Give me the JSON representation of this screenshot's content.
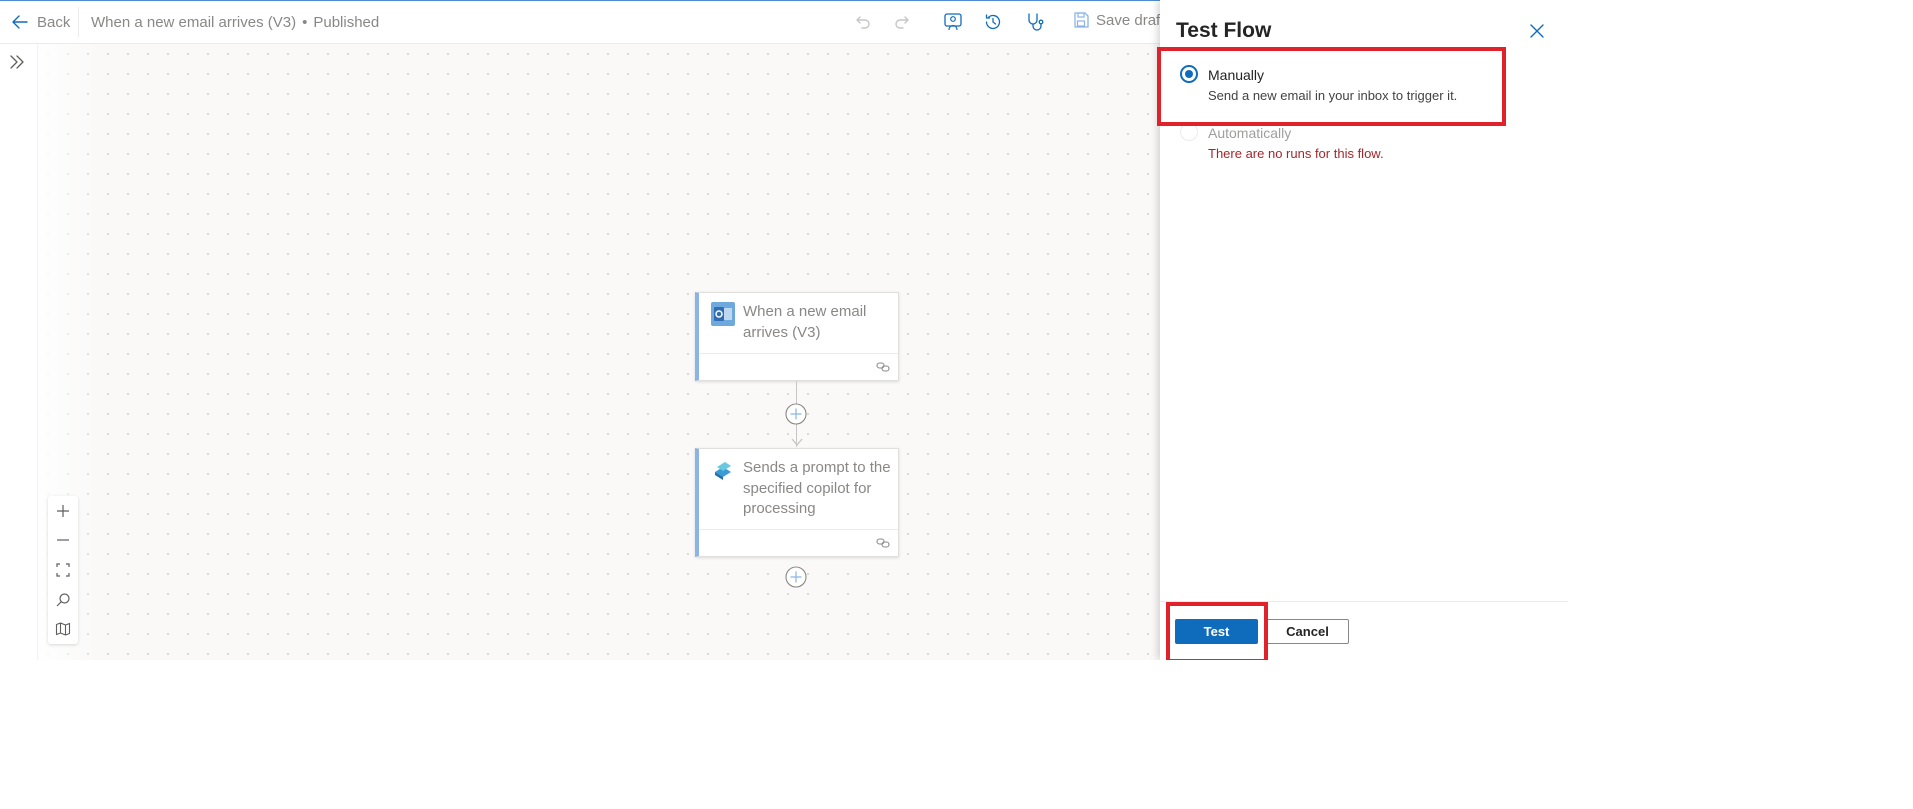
{
  "header": {
    "back_label": "Back",
    "flow_name": "When a new email arrives (V3)",
    "flow_status": "Published",
    "separator": "•",
    "save_draft_label": "Save draft"
  },
  "canvas": {
    "nodes": [
      {
        "title": "When a new email arrives (V3)",
        "icon": "outlook-icon"
      },
      {
        "title": "Sends a prompt to the specified copilot for processing",
        "icon": "copilot-icon"
      }
    ]
  },
  "panel": {
    "title": "Test Flow",
    "options": [
      {
        "label": "Manually",
        "description": "Send a new email in your inbox to trigger it.",
        "selected": true
      },
      {
        "label": "Automatically",
        "description": "There are no runs for this flow.",
        "selected": false,
        "disabled": true
      }
    ],
    "test_label": "Test",
    "cancel_label": "Cancel"
  },
  "colors": {
    "primary": "#0f6cbd",
    "error_text": "#a4262c",
    "annotation": "#e0222b",
    "node_accent": "#8ab4e8"
  }
}
